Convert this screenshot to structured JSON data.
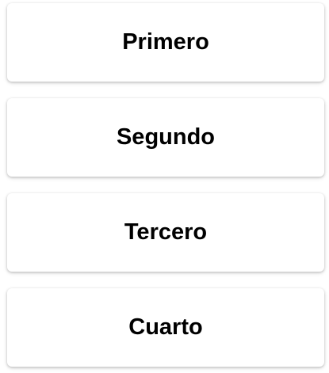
{
  "cards": [
    {
      "label": "Primero"
    },
    {
      "label": "Segundo"
    },
    {
      "label": "Tercero"
    },
    {
      "label": "Cuarto"
    }
  ]
}
